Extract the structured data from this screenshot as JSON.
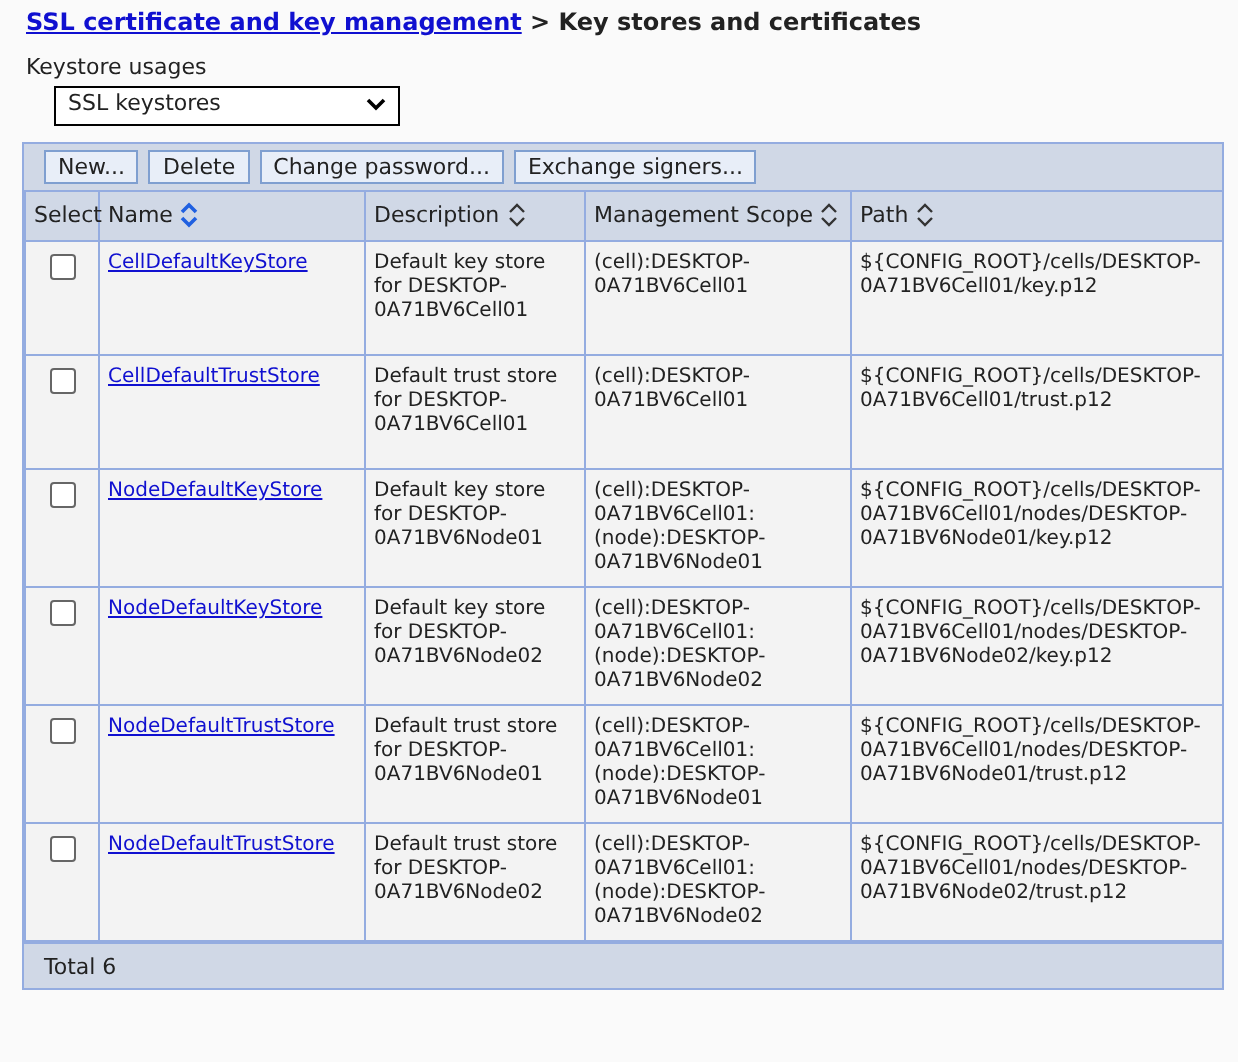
{
  "breadcrumb": {
    "link": "SSL certificate and key management",
    "separator": ">",
    "current": "Key stores and certificates"
  },
  "keystore_usages": {
    "label": "Keystore usages",
    "value": "SSL keystores"
  },
  "buttons": [
    "New...",
    "Delete",
    "Change password...",
    "Exchange signers..."
  ],
  "table": {
    "columns": [
      {
        "label": "Select",
        "sortable": false,
        "sorted": false
      },
      {
        "label": "Name",
        "sortable": true,
        "sorted": true
      },
      {
        "label": "Description",
        "sortable": true,
        "sorted": false
      },
      {
        "label": "Management Scope",
        "sortable": true,
        "sorted": false
      },
      {
        "label": "Path",
        "sortable": true,
        "sorted": false
      }
    ],
    "rows": [
      {
        "checked": false,
        "name": "CellDefaultKeyStore",
        "description": "Default key store for DESKTOP-0A71BV6Cell01",
        "scope": "(cell):DESKTOP-0A71BV6Cell01",
        "path": "${CONFIG_ROOT}/cells/DESKTOP-0A71BV6Cell01/key.p12"
      },
      {
        "checked": false,
        "name": "CellDefaultTrustStore",
        "description": "Default trust store for DESKTOP-0A71BV6Cell01",
        "scope": "(cell):DESKTOP-0A71BV6Cell01",
        "path": "${CONFIG_ROOT}/cells/DESKTOP-0A71BV6Cell01/trust.p12"
      },
      {
        "checked": false,
        "name": "NodeDefaultKeyStore",
        "description": "Default key store for DESKTOP-0A71BV6Node01",
        "scope": "(cell):DESKTOP-0A71BV6Cell01:(node):DESKTOP-0A71BV6Node01",
        "path": "${CONFIG_ROOT}/cells/DESKTOP-0A71BV6Cell01/nodes/DESKTOP-0A71BV6Node01/key.p12"
      },
      {
        "checked": false,
        "name": "NodeDefaultKeyStore",
        "description": "Default key store for DESKTOP-0A71BV6Node02",
        "scope": "(cell):DESKTOP-0A71BV6Cell01:(node):DESKTOP-0A71BV6Node02",
        "path": "${CONFIG_ROOT}/cells/DESKTOP-0A71BV6Cell01/nodes/DESKTOP-0A71BV6Node02/key.p12"
      },
      {
        "checked": false,
        "name": "NodeDefaultTrustStore",
        "description": "Default trust store for DESKTOP-0A71BV6Node01",
        "scope": "(cell):DESKTOP-0A71BV6Cell01:(node):DESKTOP-0A71BV6Node01",
        "path": "${CONFIG_ROOT}/cells/DESKTOP-0A71BV6Cell01/nodes/DESKTOP-0A71BV6Node01/trust.p12"
      },
      {
        "checked": false,
        "name": "NodeDefaultTrustStore",
        "description": "Default trust store for DESKTOP-0A71BV6Node02",
        "scope": "(cell):DESKTOP-0A71BV6Cell01:(node):DESKTOP-0A71BV6Node02",
        "path": "${CONFIG_ROOT}/cells/DESKTOP-0A71BV6Cell01/nodes/DESKTOP-0A71BV6Node02/trust.p12"
      }
    ],
    "footer": "Total 6"
  }
}
